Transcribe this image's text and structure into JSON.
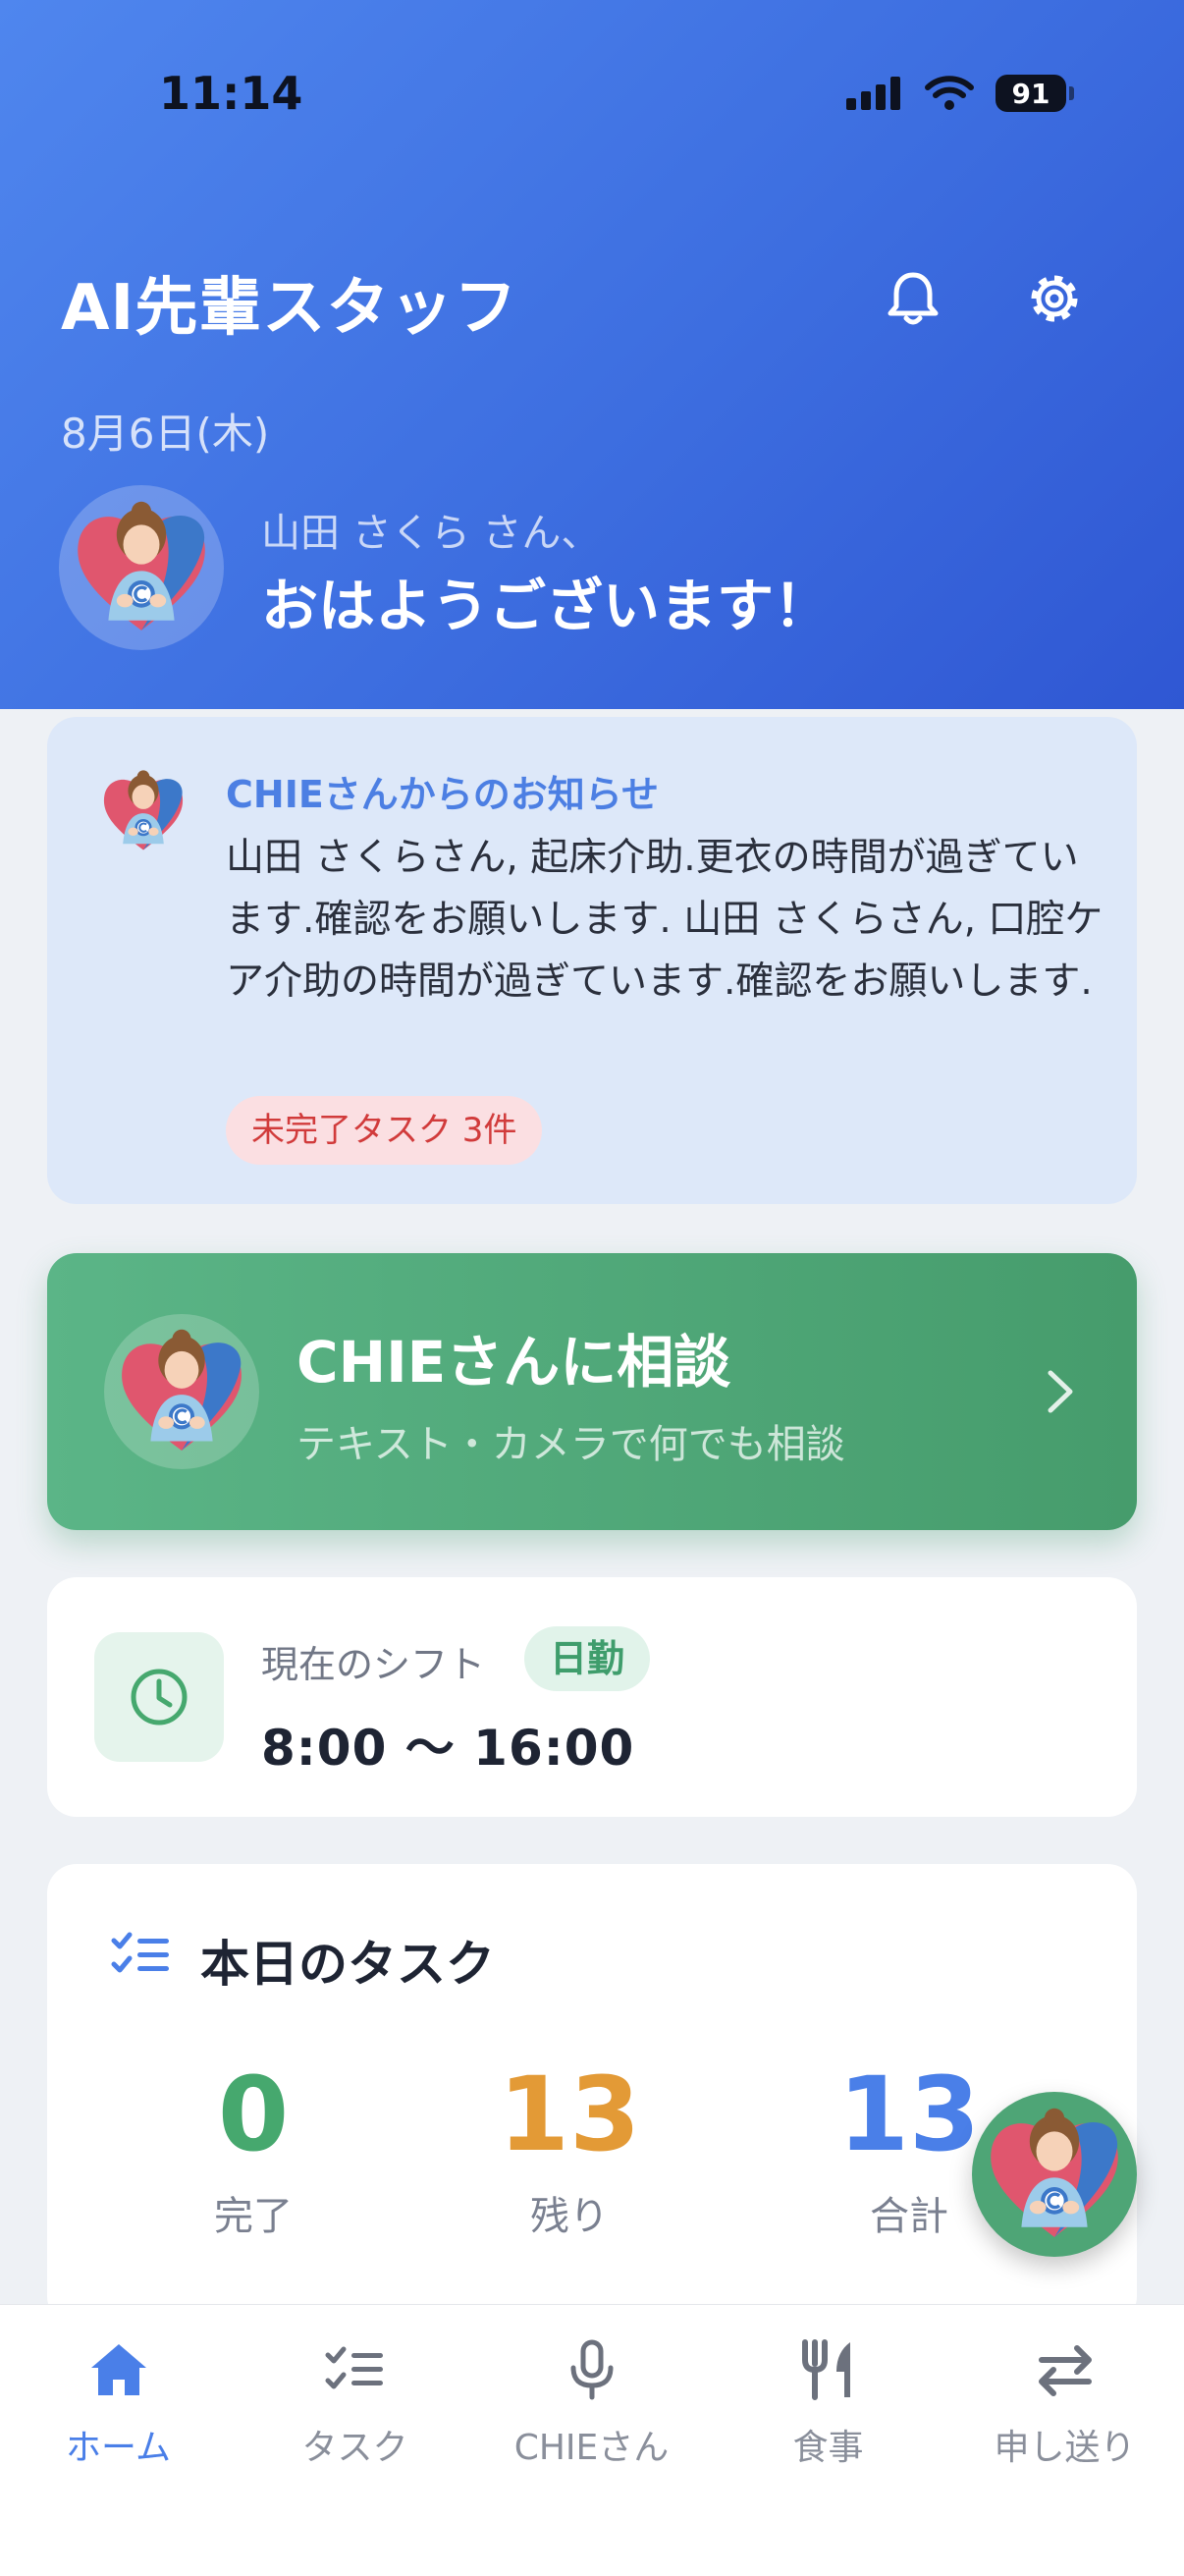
{
  "status_bar": {
    "time": "11:14",
    "battery": "91"
  },
  "header": {
    "title": "AI先輩スタッフ",
    "date": "8月6日(木)",
    "greeting_name": "山田 さくら さん、",
    "greeting": "おはようございます！"
  },
  "notice": {
    "title": "CHIEさんからのお知らせ",
    "body": "山田 さくらさん, 起床介助.更衣の時間が過ぎています.確認をお願いします. 山田 さくらさん, 口腔ケア介助の時間が過ぎています.確認をお願いします.",
    "badge": "未完了タスク 3件"
  },
  "consult": {
    "title": "CHIEさんに相談",
    "subtitle": "テキスト・カメラで何でも相談"
  },
  "shift": {
    "label": "現在のシフト",
    "badge": "日勤",
    "time": "8:00 〜 16:00"
  },
  "tasks": {
    "title": "本日のタスク",
    "stats": [
      {
        "value": "0",
        "label": "完了",
        "color": "#46a86e"
      },
      {
        "value": "13",
        "label": "残り",
        "color": "#e39a36"
      },
      {
        "value": "13",
        "label": "合計",
        "color": "#4a7fe8"
      }
    ]
  },
  "tabbar": {
    "items": [
      {
        "label": "ホーム",
        "icon": "home-icon",
        "active": true
      },
      {
        "label": "タスク",
        "icon": "checklist-icon",
        "active": false
      },
      {
        "label": "CHIEさん",
        "icon": "microphone-icon",
        "active": false
      },
      {
        "label": "食事",
        "icon": "fork-knife-icon",
        "active": false
      },
      {
        "label": "申し送り",
        "icon": "swap-arrows-icon",
        "active": false
      }
    ]
  },
  "colors": {
    "header_gradient": [
      "#4f86ee",
      "#2f57d3"
    ],
    "consult_green": "#4ea576",
    "accent_blue": "#4a7fe8"
  }
}
